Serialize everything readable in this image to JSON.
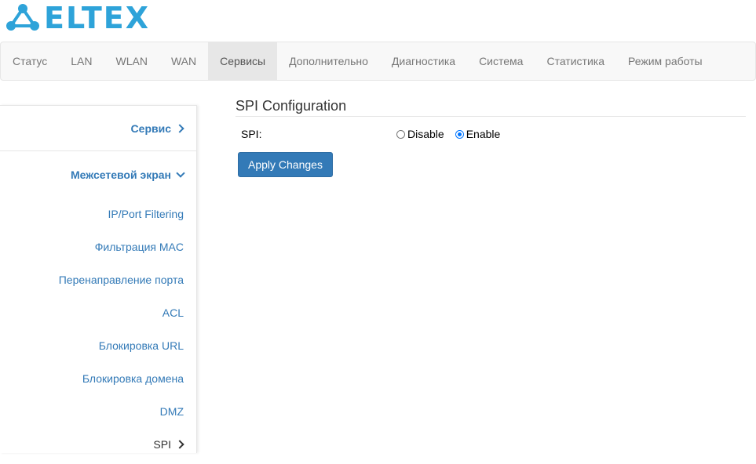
{
  "brand": {
    "logo_text": "ELTEX",
    "logo_color": "#2ea3d9"
  },
  "nav": {
    "items": [
      {
        "label": "Статус"
      },
      {
        "label": "LAN"
      },
      {
        "label": "WLAN"
      },
      {
        "label": "WAN"
      },
      {
        "label": "Сервисы",
        "active": true
      },
      {
        "label": "Дополнительно"
      },
      {
        "label": "Диагностика"
      },
      {
        "label": "Система"
      },
      {
        "label": "Статистика"
      },
      {
        "label": "Режим работы"
      }
    ]
  },
  "sidebar": {
    "service_label": "Сервис",
    "service_icon": "chevron-right-icon",
    "firewall_label": "Межсетевой экран",
    "firewall_icon": "chevron-down-icon",
    "items": [
      {
        "label": "IP/Port Filtering"
      },
      {
        "label": "Фильтрация MAC"
      },
      {
        "label": "Перенаправление порта"
      },
      {
        "label": "ACL"
      },
      {
        "label": "Блокировка URL"
      },
      {
        "label": "Блокировка домена"
      },
      {
        "label": "DMZ"
      },
      {
        "label": "SPI",
        "current": true,
        "icon": "chevron-right-icon"
      }
    ]
  },
  "main": {
    "title": "SPI Configuration",
    "spi_label": "SPI:",
    "options": [
      {
        "label": "Disable",
        "checked": false
      },
      {
        "label": "Enable",
        "checked": true
      }
    ],
    "apply_label": "Apply Changes"
  },
  "colors": {
    "link": "#337ab7",
    "button": "#337ab7",
    "nav_active_bg": "#e7e7e7",
    "radio_checked": "#0075ff"
  }
}
